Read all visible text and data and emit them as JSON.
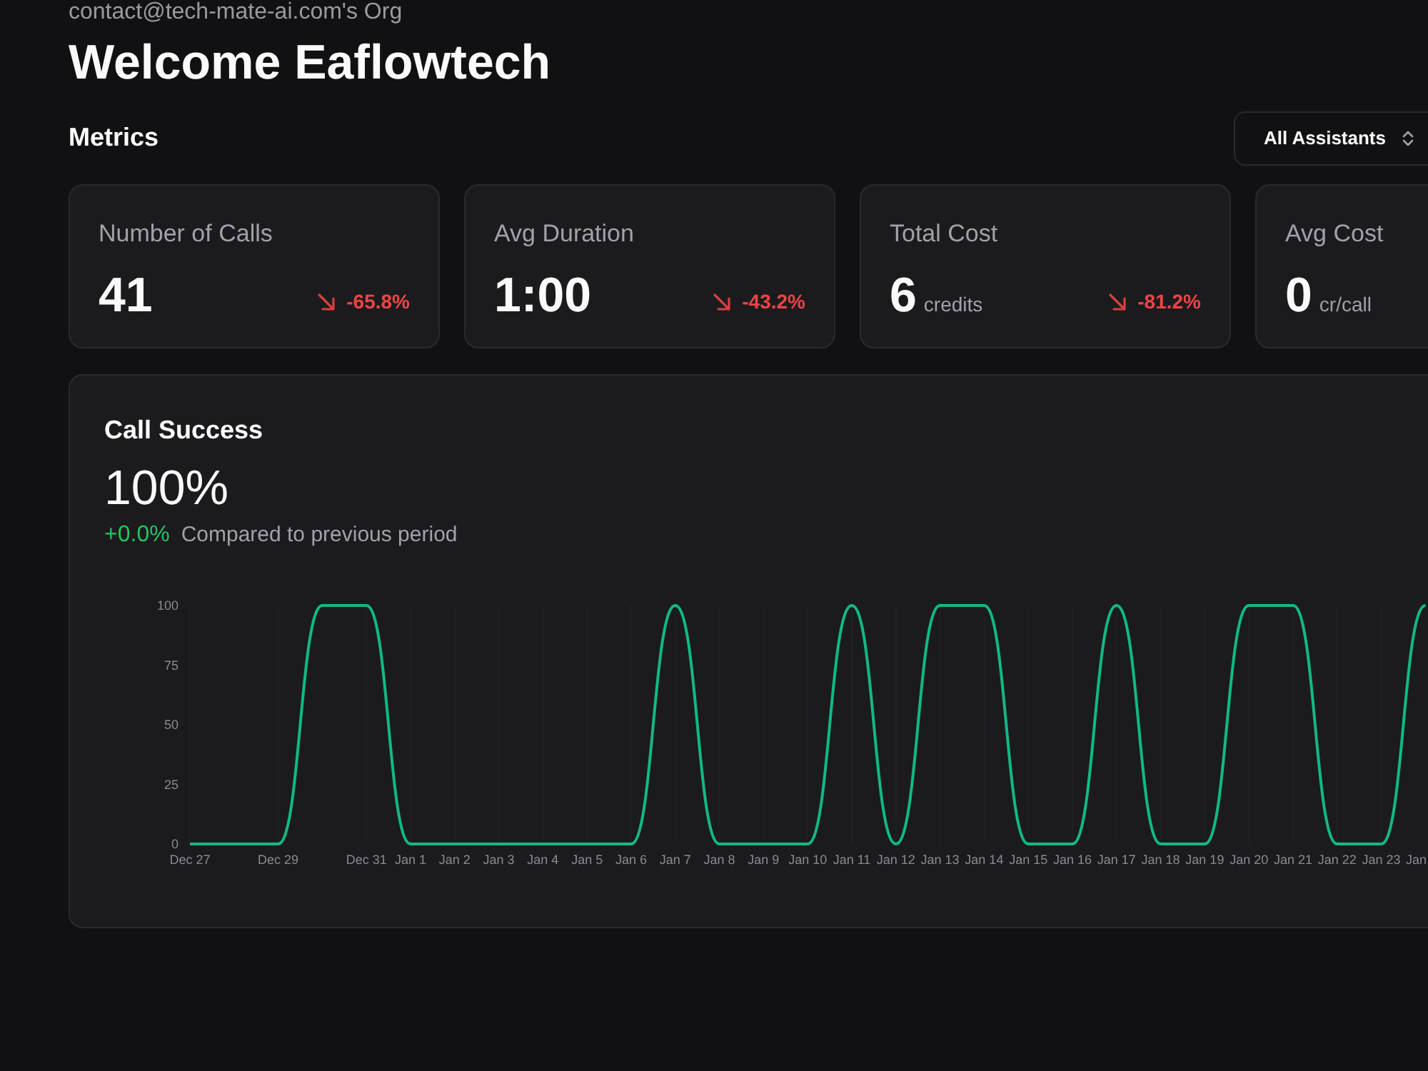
{
  "org_label": "contact@tech-mate-ai.com's Org",
  "heading": "Welcome Eaflowtech",
  "metrics": {
    "title": "Metrics",
    "assistant_filter": {
      "label": "All Assistants"
    }
  },
  "metric_cards": [
    {
      "label": "Number of Calls",
      "value": "41",
      "change": "-65.8%",
      "declining": true
    },
    {
      "label": "Avg Duration",
      "value": "1:00",
      "change": "-43.2%",
      "declining": true
    },
    {
      "label": "Total Cost",
      "value": "6",
      "unit": "credits",
      "change": "-81.2%",
      "declining": true
    },
    {
      "label": "Avg Cost",
      "value": "0",
      "unit": "cr/call"
    }
  ],
  "call_success": {
    "title": "Call Success",
    "value": "100%",
    "change": "+0.0%",
    "declining": false,
    "comparison": "Compared to previous period",
    "chart_data": {
      "type": "line",
      "categories": [
        "Dec 27",
        null,
        "Dec 29",
        null,
        "Dec 31",
        "Jan 1",
        "Jan 2",
        "Jan 3",
        "Jan 4",
        "Jan 5",
        "Jan 6",
        "Jan 7",
        "Jan 8",
        "Jan 9",
        "Jan 10",
        "Jan 11",
        "Jan 12",
        "Jan 13",
        "Jan 14",
        "Jan 15",
        "Jan 16",
        "Jan 17",
        "Jan 18",
        "Jan 19",
        "Jan 20",
        "Jan 21",
        "Jan 22",
        "Jan 23",
        "Jan"
      ],
      "values": [
        0,
        0,
        0,
        100,
        100,
        0,
        0,
        0,
        0,
        0,
        0,
        100,
        0,
        0,
        0,
        100,
        0,
        100,
        100,
        0,
        0,
        100,
        0,
        0,
        100,
        100,
        0,
        0,
        100
      ],
      "ylim": [
        0,
        100
      ],
      "yticks": [
        0,
        25,
        50,
        75,
        100
      ],
      "grid": true
    }
  }
}
